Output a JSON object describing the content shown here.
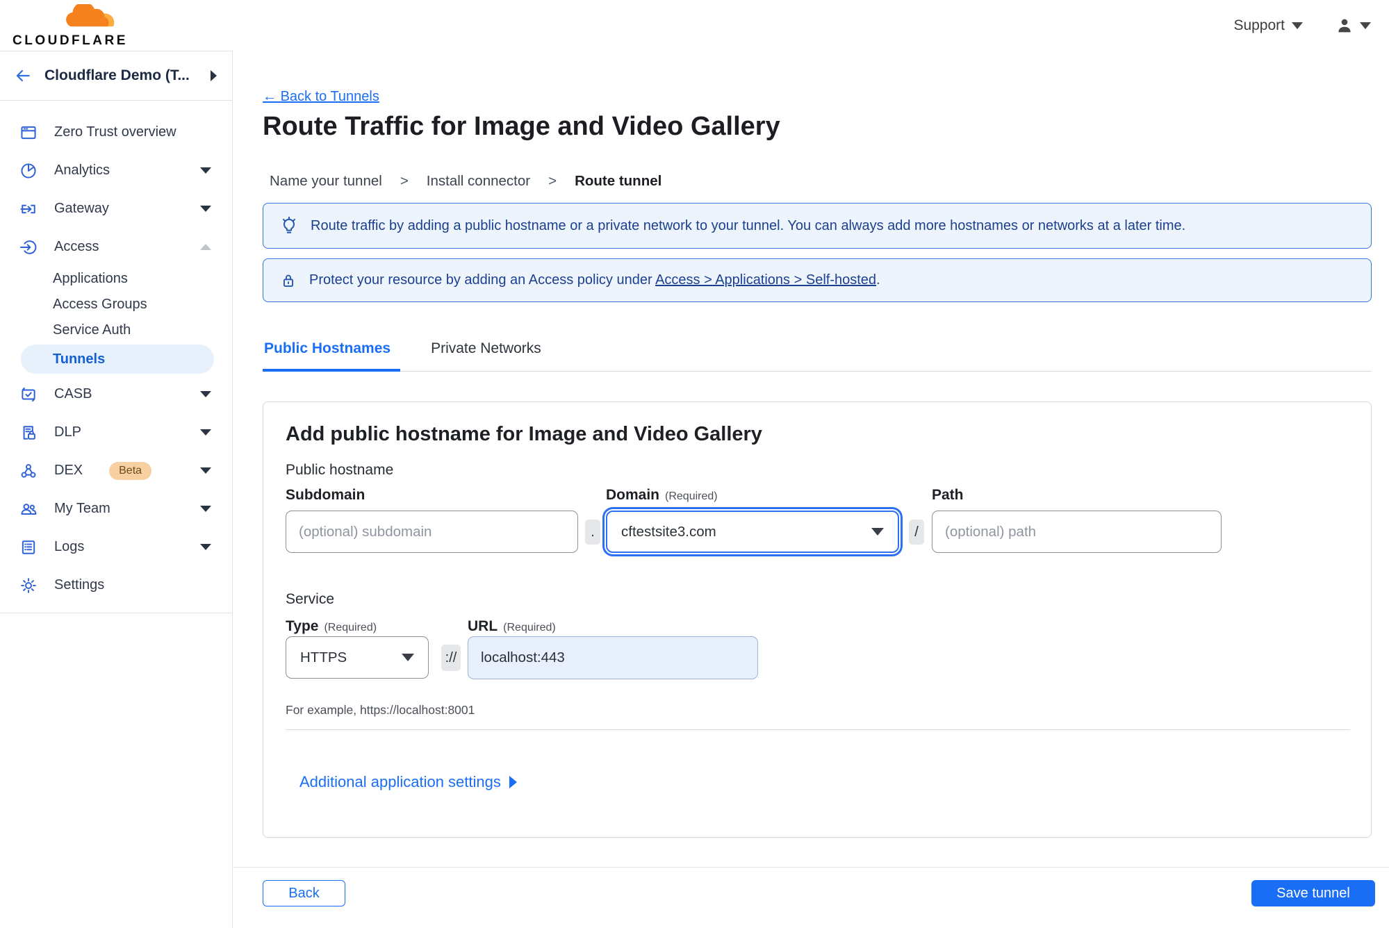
{
  "colors": {
    "accent_blue": "#1a6ef5",
    "banner_bg": "#edf4fc",
    "banner_border": "#3a74d5",
    "banner_text": "#1c3f8e",
    "selected_item_bg": "#e7f1fc",
    "beta_badge_bg": "#f8cfa1",
    "logo_orange": "#f6821f",
    "logo_orange_light": "#fbad41"
  },
  "header": {
    "logo_text": "CLOUDFLARE",
    "support_label": "Support"
  },
  "sidebar": {
    "team_name": "Cloudflare Demo (T...",
    "nav": {
      "overview": "Zero Trust overview",
      "analytics": "Analytics",
      "gateway": "Gateway",
      "access": "Access",
      "applications": "Applications",
      "access_groups": "Access Groups",
      "service_auth": "Service Auth",
      "tunnels": "Tunnels",
      "casb": "CASB",
      "dlp": "DLP",
      "dex": "DEX",
      "dex_badge": "Beta",
      "my_team": "My Team",
      "logs": "Logs",
      "settings": "Settings"
    }
  },
  "main": {
    "back_arrow": "←",
    "back_link": "Back to Tunnels",
    "title": "Route Traffic for Image and Video Gallery",
    "steps": {
      "separator": ">",
      "step1": "Name your tunnel",
      "step2": "Install connector",
      "step3": "Route tunnel"
    },
    "banner_info": "Route traffic by adding a public hostname or a private network to your tunnel. You can always add more hostnames or networks at a later time.",
    "banner_protect_prefix": "Protect your resource by adding an Access policy under",
    "banner_protect_link": "Access > Applications > Self-hosted",
    "banner_protect_suffix": ".",
    "tabs": {
      "public_hostnames": "Public Hostnames",
      "private_networks": "Private Networks"
    },
    "card": {
      "heading": "Add public hostname for Image and Video Gallery",
      "public_hostname_label": "Public hostname",
      "subdomain_label": "Subdomain",
      "subdomain_placeholder": "(optional) subdomain",
      "dot_separator": ".",
      "domain_label": "Domain",
      "required_label": "(Required)",
      "domain_value": "cftestsite3.com",
      "slash_separator": "/",
      "path_label": "Path",
      "path_placeholder": "(optional) path",
      "service_label": "Service",
      "type_label": "Type",
      "type_value": "HTTPS",
      "scheme_separator": "://",
      "url_label": "URL",
      "url_value": "localhost:443",
      "example_text": "For example, https://localhost:8001",
      "additional_settings_label": "Additional application settings"
    },
    "footer": {
      "back_button": "Back",
      "save_button": "Save tunnel"
    }
  }
}
